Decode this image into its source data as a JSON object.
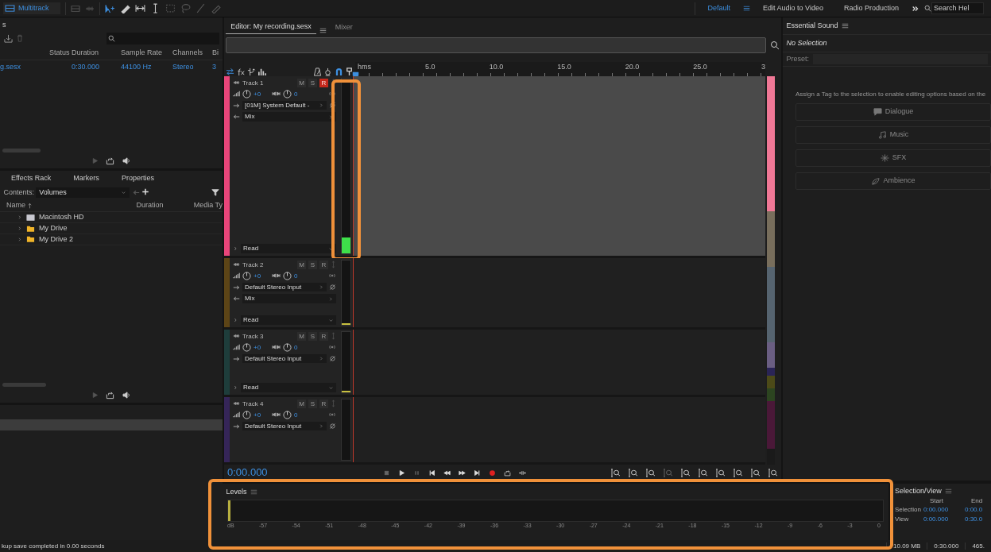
{
  "top_bar": {
    "mode_button": "Multitrack",
    "workspaces": [
      {
        "label": "Default",
        "selected": true
      },
      {
        "label": "Edit Audio to Video",
        "selected": false
      },
      {
        "label": "Radio Production",
        "selected": false
      }
    ],
    "search_placeholder": "Search Hel"
  },
  "files_panel": {
    "title": "s",
    "columns": [
      "Status",
      "Duration",
      "Sample Rate",
      "Channels",
      "Bi"
    ],
    "rows": [
      {
        "name": "g.sesx",
        "duration": "0:30.000",
        "sample_rate": "44100 Hz",
        "channels": "Stereo",
        "bits": "3"
      }
    ]
  },
  "media_panel": {
    "tabs": [
      "Effects Rack",
      "Markers",
      "Properties"
    ],
    "contents_label": "Contents:",
    "contents_value": "Volumes",
    "columns": [
      "Name",
      "Duration",
      "Media Ty"
    ],
    "items": [
      {
        "name": "Macintosh HD",
        "kind": "disk"
      },
      {
        "name": "My Drive",
        "kind": "folder"
      },
      {
        "name": "My Drive 2",
        "kind": "folder"
      }
    ]
  },
  "editor": {
    "tabs": [
      {
        "label": "Editor: My recording.sesx",
        "selected": true
      },
      {
        "label": "Mixer",
        "selected": false
      }
    ],
    "ruler": {
      "unit": "hms",
      "labels": [
        "5.0",
        "10.0",
        "15.0",
        "20.0",
        "25.0",
        "3"
      ]
    },
    "tracks": [
      {
        "name": "Track 1",
        "color": "#e8457a",
        "selected": true,
        "buttons": [
          {
            "label": "M",
            "on": false
          },
          {
            "label": "S",
            "on": false
          },
          {
            "label": "R",
            "on": true
          }
        ],
        "volume": "+0",
        "pan": "0",
        "input": "[01M] System Default -",
        "output": "Mix",
        "automation": "Read",
        "level": 0.09
      },
      {
        "name": "Track 2",
        "color": "#5c4416",
        "selected": false,
        "buttons": [
          {
            "label": "M",
            "on": false
          },
          {
            "label": "S",
            "on": false
          },
          {
            "label": "R",
            "on": false
          }
        ],
        "volume": "+0",
        "pan": "0",
        "input": "Default Stereo Input",
        "output": "Mix",
        "automation": "Read",
        "level": 0.02
      },
      {
        "name": "Track 3",
        "color": "#1e3d3b",
        "selected": false,
        "buttons": [
          {
            "label": "M",
            "on": false
          },
          {
            "label": "S",
            "on": false
          },
          {
            "label": "R",
            "on": false
          }
        ],
        "volume": "+0",
        "pan": "0",
        "input": "Default Stereo Input",
        "automation": "Read",
        "level": 0.02
      },
      {
        "name": "Track 4",
        "color": "#352558",
        "selected": false,
        "buttons": [
          {
            "label": "M",
            "on": false
          },
          {
            "label": "S",
            "on": false
          },
          {
            "label": "R",
            "on": false
          }
        ],
        "volume": "+0",
        "pan": "0",
        "input": "Default Stereo Input"
      }
    ],
    "time": "0:00.000"
  },
  "essential_sound": {
    "title": "Essential Sound",
    "status": "No Selection",
    "preset_label": "Preset:",
    "hint": "Assign a Tag to the selection to enable editing options based on the",
    "tags": [
      {
        "label": "Dialogue",
        "kind": "dialogue",
        "disabled": true
      },
      {
        "label": "Music",
        "kind": "music",
        "disabled": true
      },
      {
        "label": "SFX",
        "kind": "sfx",
        "disabled": true
      },
      {
        "label": "Ambience",
        "kind": "ambience",
        "disabled": true
      }
    ]
  },
  "levels": {
    "title": "Levels",
    "level": 0.004,
    "scale": [
      "dB",
      "-57",
      "-54",
      "-51",
      "-48",
      "-45",
      "-42",
      "-39",
      "-36",
      "-33",
      "-30",
      "-27",
      "-24",
      "-21",
      "-18",
      "-15",
      "-12",
      "-9",
      "-6",
      "-3",
      "0"
    ]
  },
  "selection_view": {
    "title": "Selection/View",
    "columns": [
      "Start",
      "End"
    ],
    "rows": [
      {
        "label": "Selection",
        "start": "0:00.000",
        "end": "0:00.0"
      },
      {
        "label": "View",
        "start": "0:00.000",
        "end": "0:30.0"
      }
    ]
  },
  "status_bar": {
    "message": "kup save completed in 0.00 seconds",
    "fields": [
      "10.09 MB",
      "0:30.000",
      "465."
    ]
  }
}
